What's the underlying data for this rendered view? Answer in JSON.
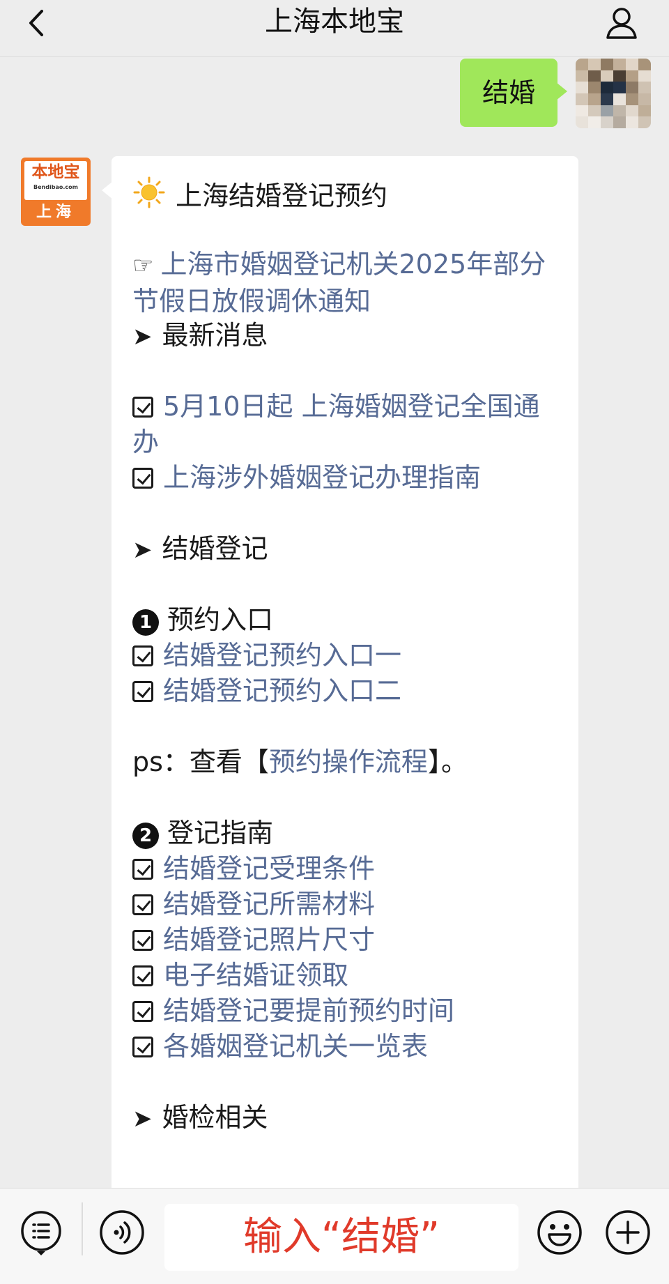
{
  "header": {
    "title": "上海本地宝",
    "back_icon": "chevron-left-icon",
    "profile_icon": "person-icon"
  },
  "user_message": {
    "text": "结婚"
  },
  "bot": {
    "avatar": {
      "logo_text": "本地宝",
      "logo_sub": "Bendibao.com",
      "city": "上海"
    },
    "message": {
      "title": "上海结婚登记预约",
      "notice_link": "上海市婚姻登记机关2025年部分节假日放假调休通知",
      "section_latest": "最新消息",
      "latest_links": [
        "5月10日起 上海婚姻登记全国通办",
        "上海涉外婚姻登记办理指南"
      ],
      "section_marriage": "结婚登记",
      "sub_1": "预约入口",
      "booking_links": [
        "结婚登记预约入口一",
        "结婚登记预约入口二"
      ],
      "ps_prefix": "ps：查看【",
      "ps_link": "预约操作流程",
      "ps_suffix": "】。",
      "sub_2": "登记指南",
      "guide_links": [
        "结婚登记受理条件",
        "结婚登记所需材料",
        "结婚登记照片尺寸",
        "电子结婚证领取",
        "结婚登记要提前预约时间",
        "各婚姻登记机关一览表"
      ],
      "section_exam": "婚检相关"
    }
  },
  "input_bar": {
    "menu_icon": "list-menu-icon",
    "voice_icon": "voice-icon",
    "value": "输入“结婚”",
    "emoji_icon": "emoji-icon",
    "plus_icon": "plus-icon"
  },
  "colors": {
    "link": "#576b95",
    "user_bubble": "#a0e75a",
    "input_text": "#e03a2a",
    "bot_avatar": "#f07a2a"
  }
}
